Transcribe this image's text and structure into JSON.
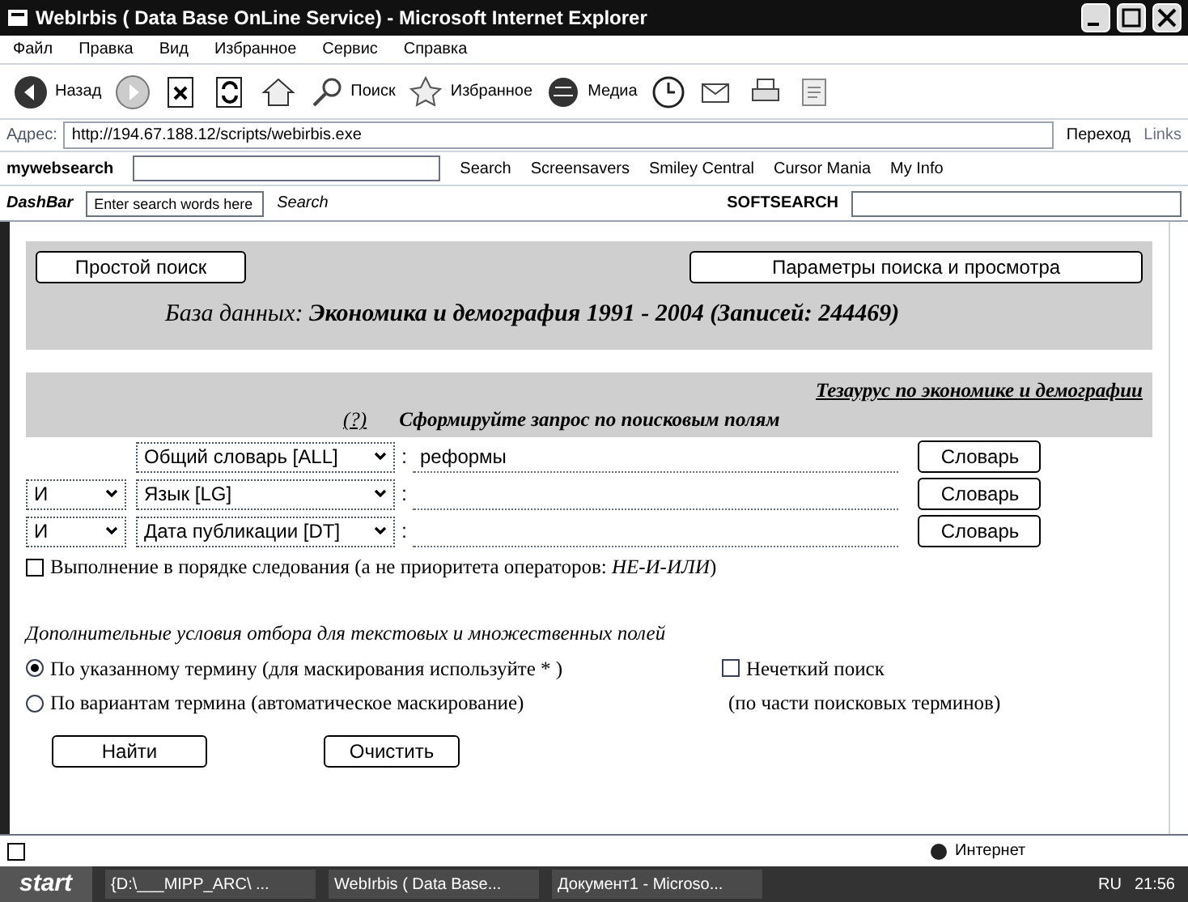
{
  "window": {
    "title": "WebIrbis ( Data Base OnLine Service) - Microsoft Internet Explorer"
  },
  "menu": [
    "Файл",
    "Правка",
    "Вид",
    "Избранное",
    "Сервис",
    "Справка"
  ],
  "toolbar": [
    {
      "kind": "back",
      "label": "Назад"
    },
    {
      "kind": "forward"
    },
    {
      "kind": "stop"
    },
    {
      "kind": "refresh"
    },
    {
      "kind": "home"
    },
    {
      "kind": "search",
      "label": "Поиск"
    },
    {
      "kind": "favorites",
      "label": "Избранное"
    },
    {
      "kind": "media",
      "label": "Медиа"
    },
    {
      "kind": "history"
    },
    {
      "kind": "mail"
    },
    {
      "kind": "print"
    },
    {
      "kind": "edit"
    }
  ],
  "address": {
    "label": "Адрес:",
    "url": "http://194.67.188.12/scripts/webirbis.exe",
    "go": "Переход",
    "links": "Links"
  },
  "websearch": {
    "brand": "mywebsearch",
    "items": [
      "Search",
      "Screensavers",
      "Smiley Central",
      "Cursor Mania",
      "My Info"
    ]
  },
  "dashbar": {
    "brand": "DashBar",
    "placeholder": "Enter search words here",
    "search": "Search",
    "softsearch": "SOFTSEARCH"
  },
  "page": {
    "simple_search": "Простой поиск",
    "params": "Параметры поиска и просмотра",
    "database": "База данных: **Экономика и демография 1991 - 2004  (Записей: 244469)**",
    "thesaurus": "Тезаурус по экономике и демографии",
    "help": "(?)",
    "heading": "Сформируйте запрос по поисковым полям",
    "rows": [
      {
        "field": "Общий словарь [ALL]",
        "separator": ":",
        "value": "реформы",
        "button": "Словарь"
      },
      {
        "operator": "И",
        "field": "Язык [LG]",
        "separator": ":",
        "button": "Словарь"
      },
      {
        "operator": "И",
        "field": "Дата публикации [DT]",
        "separator": ":",
        "button": "Словарь"
      }
    ],
    "order": {
      "label": "Выполнение в порядке следования (а не приоритета операторов: *НЕ-И-ИЛИ*)",
      "checked": false
    },
    "extra_title": "Дополнительные условия отбора для текстовых и множественных полей",
    "modes": [
      {
        "label": "По указанному термину (для маскирования используйте * )",
        "selected": true
      },
      {
        "label": "По вариантам термина (автоматическое маскирование)",
        "selected": false
      }
    ],
    "fuzzy": {
      "label": "Нечеткий поиск",
      "checked": false,
      "note": "(по части поисковых терминов)"
    },
    "find": "Найти",
    "clear": "Очистить"
  },
  "status": {
    "zone": "Интернет"
  },
  "taskbar": {
    "start": "start",
    "tasks": [
      "{D:\\___MIPP_ARC\\ ...",
      "WebIrbis ( Data Base...",
      "Документ1 - Microso..."
    ],
    "lang": "RU",
    "time": "21:56"
  }
}
